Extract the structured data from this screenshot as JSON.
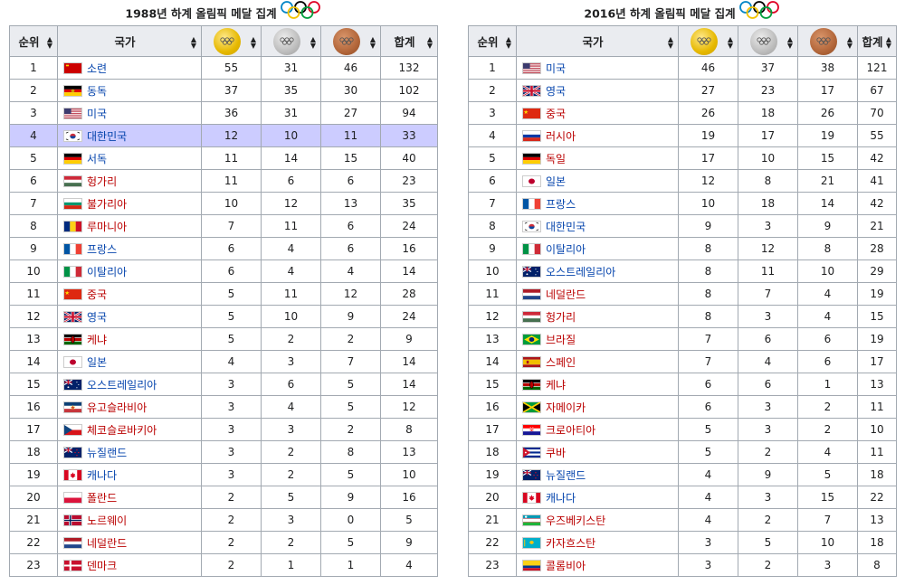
{
  "tables": [
    {
      "id": "left",
      "title": "1988년 하계 올림픽 메달 집계",
      "headers": {
        "rank": "순위",
        "nation": "국가",
        "total": "합계"
      },
      "medal_icons": [
        "gold-medal-icon",
        "silver-medal-icon",
        "bronze-medal-icon"
      ],
      "highlight_rank": "4",
      "rows": [
        {
          "rank": "1",
          "flag": "ussr",
          "name": "소련",
          "g": "55",
          "s": "31",
          "b": "46",
          "t": "132"
        },
        {
          "rank": "2",
          "flag": "gdr",
          "name": "동독",
          "g": "37",
          "s": "35",
          "b": "30",
          "t": "102"
        },
        {
          "rank": "3",
          "flag": "usa",
          "name": "미국",
          "g": "36",
          "s": "31",
          "b": "27",
          "t": "94"
        },
        {
          "rank": "4",
          "flag": "kor",
          "name": "대한민국",
          "g": "12",
          "s": "10",
          "b": "11",
          "t": "33"
        },
        {
          "rank": "5",
          "flag": "ger",
          "name": "서독",
          "g": "11",
          "s": "14",
          "b": "15",
          "t": "40"
        },
        {
          "rank": "6",
          "flag": "hun",
          "name": "헝가리",
          "g": "11",
          "s": "6",
          "b": "6",
          "t": "23"
        },
        {
          "rank": "7",
          "flag": "bul",
          "name": "불가리아",
          "g": "10",
          "s": "12",
          "b": "13",
          "t": "35"
        },
        {
          "rank": "8",
          "flag": "rou",
          "name": "루마니아",
          "g": "7",
          "s": "11",
          "b": "6",
          "t": "24"
        },
        {
          "rank": "9",
          "flag": "fra",
          "name": "프랑스",
          "g": "6",
          "s": "4",
          "b": "6",
          "t": "16"
        },
        {
          "rank": "10",
          "flag": "ita",
          "name": "이탈리아",
          "g": "6",
          "s": "4",
          "b": "4",
          "t": "14"
        },
        {
          "rank": "11",
          "flag": "chn",
          "name": "중국",
          "g": "5",
          "s": "11",
          "b": "12",
          "t": "28"
        },
        {
          "rank": "12",
          "flag": "gbr",
          "name": "영국",
          "g": "5",
          "s": "10",
          "b": "9",
          "t": "24"
        },
        {
          "rank": "13",
          "flag": "ken",
          "name": "케냐",
          "g": "5",
          "s": "2",
          "b": "2",
          "t": "9"
        },
        {
          "rank": "14",
          "flag": "jpn",
          "name": "일본",
          "g": "4",
          "s": "3",
          "b": "7",
          "t": "14"
        },
        {
          "rank": "15",
          "flag": "aus",
          "name": "오스트레일리아",
          "g": "3",
          "s": "6",
          "b": "5",
          "t": "14"
        },
        {
          "rank": "16",
          "flag": "yug",
          "name": "유고슬라비아",
          "g": "3",
          "s": "4",
          "b": "5",
          "t": "12"
        },
        {
          "rank": "17",
          "flag": "tch",
          "name": "체코슬로바키아",
          "g": "3",
          "s": "3",
          "b": "2",
          "t": "8"
        },
        {
          "rank": "18",
          "flag": "nzl",
          "name": "뉴질랜드",
          "g": "3",
          "s": "2",
          "b": "8",
          "t": "13"
        },
        {
          "rank": "19",
          "flag": "can",
          "name": "캐나다",
          "g": "3",
          "s": "2",
          "b": "5",
          "t": "10"
        },
        {
          "rank": "20",
          "flag": "pol",
          "name": "폴란드",
          "g": "2",
          "s": "5",
          "b": "9",
          "t": "16"
        },
        {
          "rank": "21",
          "flag": "nor",
          "name": "노르웨이",
          "g": "2",
          "s": "3",
          "b": "0",
          "t": "5"
        },
        {
          "rank": "22",
          "flag": "ned",
          "name": "네덜란드",
          "g": "2",
          "s": "2",
          "b": "5",
          "t": "9"
        },
        {
          "rank": "23",
          "flag": "den",
          "name": "덴마크",
          "g": "2",
          "s": "1",
          "b": "1",
          "t": "4"
        }
      ]
    },
    {
      "id": "right",
      "title": "2016년 하계 올림픽 메달 집계",
      "headers": {
        "rank": "순위",
        "nation": "국가",
        "total": "합계"
      },
      "medal_icons": [
        "gold-medal-icon",
        "silver-medal-icon",
        "bronze-medal-icon"
      ],
      "highlight_rank": "",
      "rows": [
        {
          "rank": "1",
          "flag": "usa",
          "name": "미국",
          "g": "46",
          "s": "37",
          "b": "38",
          "t": "121"
        },
        {
          "rank": "2",
          "flag": "gbr",
          "name": "영국",
          "g": "27",
          "s": "23",
          "b": "17",
          "t": "67"
        },
        {
          "rank": "3",
          "flag": "chn",
          "name": "중국",
          "g": "26",
          "s": "18",
          "b": "26",
          "t": "70"
        },
        {
          "rank": "4",
          "flag": "rus",
          "name": "러시아",
          "g": "19",
          "s": "17",
          "b": "19",
          "t": "55"
        },
        {
          "rank": "5",
          "flag": "ger",
          "name": "독일",
          "g": "17",
          "s": "10",
          "b": "15",
          "t": "42"
        },
        {
          "rank": "6",
          "flag": "jpn",
          "name": "일본",
          "g": "12",
          "s": "8",
          "b": "21",
          "t": "41"
        },
        {
          "rank": "7",
          "flag": "fra",
          "name": "프랑스",
          "g": "10",
          "s": "18",
          "b": "14",
          "t": "42"
        },
        {
          "rank": "8",
          "flag": "kor",
          "name": "대한민국",
          "g": "9",
          "s": "3",
          "b": "9",
          "t": "21"
        },
        {
          "rank": "9",
          "flag": "ita",
          "name": "이탈리아",
          "g": "8",
          "s": "12",
          "b": "8",
          "t": "28"
        },
        {
          "rank": "10",
          "flag": "aus",
          "name": "오스트레일리아",
          "g": "8",
          "s": "11",
          "b": "10",
          "t": "29"
        },
        {
          "rank": "11",
          "flag": "ned",
          "name": "네덜란드",
          "g": "8",
          "s": "7",
          "b": "4",
          "t": "19"
        },
        {
          "rank": "12",
          "flag": "hun",
          "name": "헝가리",
          "g": "8",
          "s": "3",
          "b": "4",
          "t": "15"
        },
        {
          "rank": "13",
          "flag": "bra",
          "name": "브라질",
          "g": "7",
          "s": "6",
          "b": "6",
          "t": "19"
        },
        {
          "rank": "14",
          "flag": "esp",
          "name": "스페인",
          "g": "7",
          "s": "4",
          "b": "6",
          "t": "17"
        },
        {
          "rank": "15",
          "flag": "ken",
          "name": "케냐",
          "g": "6",
          "s": "6",
          "b": "1",
          "t": "13"
        },
        {
          "rank": "16",
          "flag": "jam",
          "name": "자메이카",
          "g": "6",
          "s": "3",
          "b": "2",
          "t": "11"
        },
        {
          "rank": "17",
          "flag": "cro",
          "name": "크로아티아",
          "g": "5",
          "s": "3",
          "b": "2",
          "t": "10"
        },
        {
          "rank": "18",
          "flag": "cub",
          "name": "쿠바",
          "g": "5",
          "s": "2",
          "b": "4",
          "t": "11"
        },
        {
          "rank": "19",
          "flag": "nzl",
          "name": "뉴질랜드",
          "g": "4",
          "s": "9",
          "b": "5",
          "t": "18"
        },
        {
          "rank": "20",
          "flag": "can",
          "name": "캐나다",
          "g": "4",
          "s": "3",
          "b": "15",
          "t": "22"
        },
        {
          "rank": "21",
          "flag": "uzb",
          "name": "우즈베키스탄",
          "g": "4",
          "s": "2",
          "b": "7",
          "t": "13"
        },
        {
          "rank": "22",
          "flag": "kaz",
          "name": "카자흐스탄",
          "g": "3",
          "s": "5",
          "b": "10",
          "t": "18"
        },
        {
          "rank": "23",
          "flag": "col",
          "name": "콜롬비아",
          "g": "3",
          "s": "2",
          "b": "3",
          "t": "8"
        }
      ]
    }
  ],
  "red_links": [
    "헝가리",
    "불가리아",
    "루마니아",
    "케냐",
    "유고슬라비아",
    "체코슬로바키아",
    "노르웨이",
    "네덜란드",
    "덴마크",
    "폴란드",
    "스페인",
    "크로아티아",
    "쿠바",
    "자메이카",
    "우즈베키스탄",
    "카자흐스탄",
    "콜롬비아",
    "브라질",
    "독일",
    "중국",
    "러시아"
  ],
  "colors": {
    "header_bg": "#eaecf0",
    "border": "#a2a9b1",
    "highlight": "#ccccff",
    "link": "#0645ad",
    "redlink": "#ba0000"
  }
}
